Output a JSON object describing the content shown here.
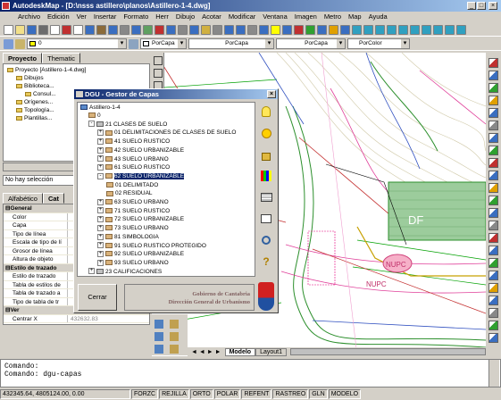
{
  "app": {
    "title": "AutodeskMap - [D:\\nsss astillero\\planos\\Astillero-1-4.dwg]"
  },
  "menu": [
    "Archivo",
    "Edición",
    "Ver",
    "Insertar",
    "Formato",
    "Herr",
    "Dibujo",
    "Acotar",
    "Modificar",
    "Ventana",
    "Imagen",
    "Metro",
    "Map",
    "Ayuda"
  ],
  "toolbar": {
    "layer_value": "0",
    "color_value": "PorCapa",
    "linetype_value": "PorCapa",
    "lineweight_value": "PorCapa",
    "plotstyle_value": "PorColor"
  },
  "left_panel": {
    "tabs": [
      "Proyecto",
      "Thematic"
    ],
    "tree": [
      {
        "label": "Proyecto [Astillero-1-4.dwg]",
        "level": 0
      },
      {
        "label": "Dibujos",
        "level": 1
      },
      {
        "label": "Biblioteca...",
        "level": 1
      },
      {
        "label": "Consul...",
        "level": 2
      },
      {
        "label": "Orígenes...",
        "level": 1
      },
      {
        "label": "Topología...",
        "level": 1
      },
      {
        "label": "Plantillas...",
        "level": 1
      }
    ],
    "selection": "No hay selección",
    "prop_tabs": [
      "Alfabético",
      "Cat"
    ],
    "props": [
      {
        "k": "General",
        "cat": true
      },
      {
        "k": "Color"
      },
      {
        "k": "Capa"
      },
      {
        "k": "Tipo de línea"
      },
      {
        "k": "Escala de tipo de lí"
      },
      {
        "k": "Grosor de línea"
      },
      {
        "k": "Altura de objeto"
      },
      {
        "k": "Estilo de trazado",
        "cat": true
      },
      {
        "k": "Estilo de trazado"
      },
      {
        "k": "Tabla de estilos de"
      },
      {
        "k": "Tabla de trazado a"
      },
      {
        "k": "Tipo de tabla de tr"
      },
      {
        "k": "Ver",
        "cat": true
      },
      {
        "k": "Centrar X",
        "v": "432632.83"
      }
    ]
  },
  "dialog": {
    "title": "DGU - Gestor de Capas",
    "root": "Astillero-1-4",
    "items": [
      {
        "label": "0",
        "level": 1,
        "type": "layer"
      },
      {
        "label": "21 CLASES DE SUELO",
        "level": 1,
        "type": "group",
        "pm": "-"
      },
      {
        "label": "01 DELIMITACIONES DE CLASES DE SUELO",
        "level": 2,
        "type": "layer",
        "pm": "+"
      },
      {
        "label": "41 SUELO RUSTICO",
        "level": 2,
        "type": "layer",
        "pm": "+"
      },
      {
        "label": "42 SUELO URBANIZABLE",
        "level": 2,
        "type": "layer",
        "pm": "+"
      },
      {
        "label": "43 SUELO URBANO",
        "level": 2,
        "type": "layer",
        "pm": "+"
      },
      {
        "label": "61 SUELO RUSTICO",
        "level": 2,
        "type": "layer",
        "pm": "+"
      },
      {
        "label": "62 SUELO URBANIZABLE",
        "level": 2,
        "type": "layer",
        "pm": "-",
        "selected": true
      },
      {
        "label": "01 DELIMITADO",
        "level": 3,
        "type": "layer"
      },
      {
        "label": "02 RESIDUAL",
        "level": 3,
        "type": "layer"
      },
      {
        "label": "63 SUELO URBANO",
        "level": 2,
        "type": "layer",
        "pm": "+"
      },
      {
        "label": "71 SUELO RUSTICO",
        "level": 2,
        "type": "layer",
        "pm": "+"
      },
      {
        "label": "72 SUELO URBANIZABLE",
        "level": 2,
        "type": "layer",
        "pm": "+"
      },
      {
        "label": "73 SUELO URBANO",
        "level": 2,
        "type": "layer",
        "pm": "+"
      },
      {
        "label": "81 SIMBOLOGIA",
        "level": 2,
        "type": "layer",
        "pm": "+"
      },
      {
        "label": "91 SUELO RUSTICO PROTEGIDO",
        "level": 2,
        "type": "layer",
        "pm": "+"
      },
      {
        "label": "92 SUELO URBANIZABLE",
        "level": 2,
        "type": "layer",
        "pm": "+"
      },
      {
        "label": "93 SUELO URBANO",
        "level": 2,
        "type": "layer",
        "pm": "+"
      },
      {
        "label": "23 CALIFICACIONES",
        "level": 1,
        "type": "group",
        "pm": "+"
      }
    ],
    "close_label": "Cerrar",
    "footer_line1": "Gobierno de Cantabria",
    "footer_line2": "Dirección General de Urbanismo"
  },
  "drawing": {
    "labels": [
      "DF",
      "NUPC",
      "NUPC"
    ],
    "tabs": [
      "Modelo",
      "Layout1"
    ]
  },
  "command": {
    "line1": "Comando:",
    "line2": "Comando: dgu-capas"
  },
  "status": {
    "coords": "432345.64, 4805124.00, 0.00",
    "toggles": [
      "FORZC",
      "REJILLA",
      "ORTO",
      "POLAR",
      "REFENT",
      "RASTREO",
      "GLN",
      "MODELO"
    ]
  }
}
